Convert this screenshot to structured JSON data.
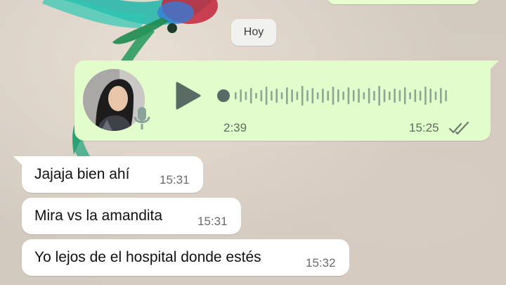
{
  "date_chip": {
    "label": "Hoy"
  },
  "voice_message": {
    "duration": "2:39",
    "time": "15:25",
    "status": "read",
    "icons": {
      "play": "play-icon",
      "mic": "microphone-icon",
      "ticks": "double-check-icon"
    }
  },
  "messages": [
    {
      "text": "Jajaja bien ahí",
      "time": "15:31"
    },
    {
      "text": "Mira vs la amandita",
      "time": "15:31"
    },
    {
      "text": "Yo lejos de el hospital donde estés",
      "time": "15:32"
    }
  ],
  "colors": {
    "outgoing_bubble": "#e2fdcb",
    "incoming_bubble": "#ffffff",
    "ticks": "#6f7a70",
    "date_chip": "#f1f1ef"
  }
}
